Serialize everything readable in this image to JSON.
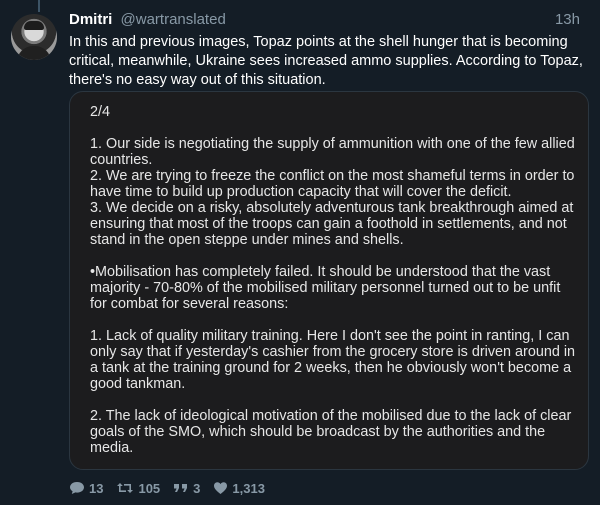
{
  "tweet": {
    "author_name": "Dmitri",
    "author_handle": "@wartranslated",
    "timestamp": "13h",
    "text": "In this and previous images, Topaz points at the shell hunger that is becoming critical, meanwhile, Ukraine sees increased ammo supplies. According to Topaz, there's no easy way out of this situation."
  },
  "image": {
    "page_indicator": "2/4",
    "points": [
      "1. Our side is negotiating the supply of ammunition with one of the few allied countries.",
      "2. We are trying to freeze the conflict on the most shameful terms in order to have time to build up production capacity that will cover the deficit.",
      "3. We decide on a risky, absolutely adventurous tank breakthrough aimed at ensuring that most of the troops can gain a foothold in settlements, and not stand in the open steppe under mines and shells."
    ],
    "mobilisation": "•Mobilisation has completely failed. It should be understood that the vast majority - 70-80% of the mobilised military personnel turned out to be unfit for combat for several reasons:",
    "reason_1": "1. Lack of quality military training. Here I don't see the point in ranting, I can only say that if yesterday's cashier from the grocery store is driven around in a tank at the training ground for 2 weeks, then he obviously won't become a good tankman.",
    "reason_2": "2. The lack of ideological motivation of the mobilised due to the lack of clear goals of the SMO, which should be broadcast by the authorities and the media."
  },
  "actions": {
    "replies": "13",
    "retweets": "105",
    "quotes": "3",
    "likes": "1,313"
  },
  "icons": {
    "reply": "reply-bubble-icon",
    "retweet": "retweet-icon",
    "quote": "quote-icon",
    "like": "heart-icon"
  },
  "colors": {
    "background": "#141d26",
    "muted_text": "#8899a6",
    "image_background": "#1c1c1e"
  }
}
